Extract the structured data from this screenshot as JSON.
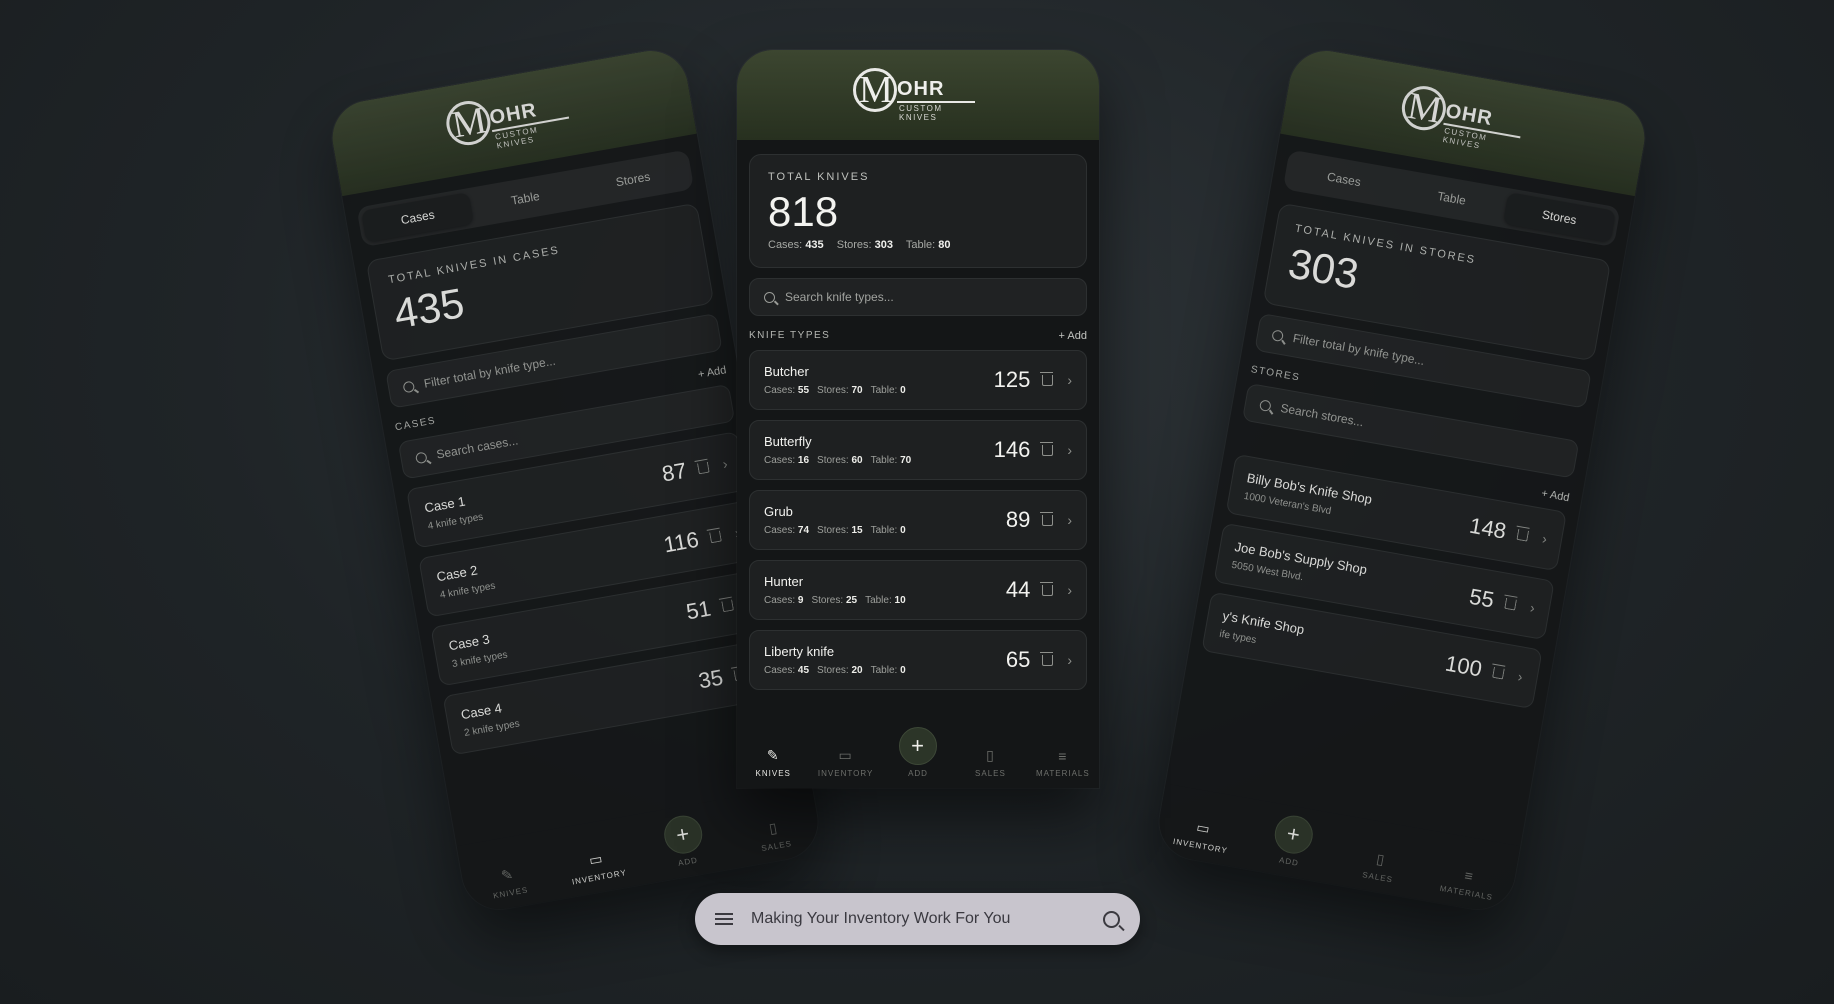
{
  "brand": {
    "mark": "M",
    "name": "OHR",
    "tagline": "CUSTOM KNIVES"
  },
  "left_phone": {
    "tabs": [
      "Cases",
      "Table",
      "Stores"
    ],
    "active_tab": "Cases",
    "total_label": "TOTAL KNIVES IN CASES",
    "total_value": "435",
    "filter_placeholder": "Filter total by knife type...",
    "add_label": "+ Add",
    "section_label": "CASES",
    "search_placeholder": "Search cases...",
    "rows": [
      {
        "name": "Case 1",
        "sub": "4 knife types",
        "count": "87"
      },
      {
        "name": "Case 2",
        "sub": "4 knife types",
        "count": "116"
      },
      {
        "name": "Case 3",
        "sub": "3 knife types",
        "count": "51"
      },
      {
        "name": "Case 4",
        "sub": "2 knife types",
        "count": "35"
      }
    ]
  },
  "center_phone": {
    "total_label": "TOTAL KNIVES",
    "total_value": "818",
    "breakdown": {
      "cases_label": "Cases:",
      "cases": "435",
      "stores_label": "Stores:",
      "stores": "303",
      "table_label": "Table:",
      "table": "80"
    },
    "search_placeholder": "Search knife types...",
    "section_label": "KNIFE TYPES",
    "add_label": "+ Add",
    "rows": [
      {
        "name": "Butcher",
        "cases": "55",
        "stores": "70",
        "table": "0",
        "count": "125"
      },
      {
        "name": "Butterfly",
        "cases": "16",
        "stores": "60",
        "table": "70",
        "count": "146"
      },
      {
        "name": "Grub",
        "cases": "74",
        "stores": "15",
        "table": "0",
        "count": "89"
      },
      {
        "name": "Hunter",
        "cases": "9",
        "stores": "25",
        "table": "10",
        "count": "44"
      },
      {
        "name": "Liberty knife",
        "cases": "45",
        "stores": "20",
        "table": "0",
        "count": "65"
      }
    ],
    "meta_labels": {
      "cases": "Cases:",
      "stores": "Stores:",
      "table": "Table:"
    }
  },
  "right_phone": {
    "tabs": [
      "Cases",
      "Table",
      "Stores"
    ],
    "active_tab": "Stores",
    "total_label": "TOTAL KNIVES IN STORES",
    "total_value": "303",
    "filter_placeholder": "Filter total by knife type...",
    "section_label": "STORES",
    "search_placeholder": "Search stores...",
    "add_label": "+ Add",
    "rows": [
      {
        "name": "Billy Bob's Knife Shop",
        "sub": "1000 Veteran's Blvd",
        "count": "148"
      },
      {
        "name": "Joe Bob's Supply Shop",
        "sub": "5050 West Blvd.",
        "count": "55"
      },
      {
        "name": "y's Knife Shop",
        "sub": "ife types",
        "count": "100"
      }
    ]
  },
  "nav": {
    "items": [
      "KNIVES",
      "INVENTORY",
      "ADD",
      "SALES",
      "MATERIALS"
    ],
    "fab_symbol": "+"
  },
  "search_bar": {
    "text": "Making Your Inventory Work For You"
  }
}
